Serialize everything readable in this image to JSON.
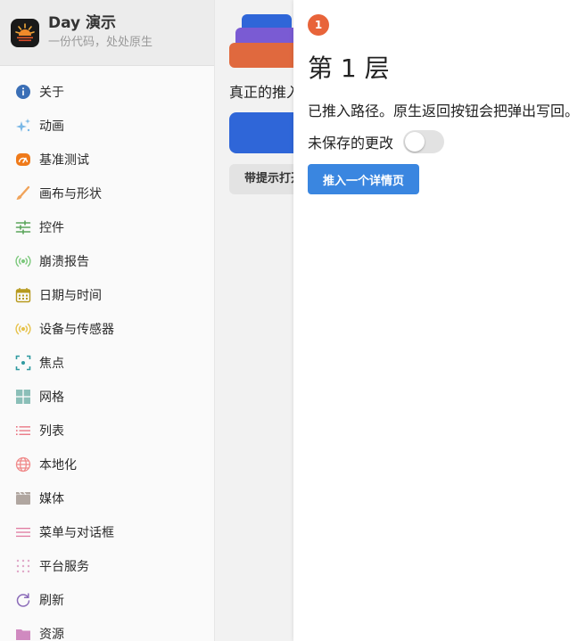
{
  "sidebar": {
    "app_name": "Day 演示",
    "app_subtitle": "一份代码，处处原生",
    "items": [
      {
        "label": "关于",
        "icon": "info-icon",
        "color": "#3b6fb6"
      },
      {
        "label": "动画",
        "icon": "sparkles-icon",
        "color": "#7ab8e6"
      },
      {
        "label": "基准测试",
        "icon": "speedometer-icon",
        "color": "#ef7a1a"
      },
      {
        "label": "画布与形状",
        "icon": "brush-icon",
        "color": "#f0a35a"
      },
      {
        "label": "控件",
        "icon": "sliders-icon",
        "color": "#5aa55a"
      },
      {
        "label": "崩溃报告",
        "icon": "radio-waves-icon",
        "color": "#7cc87c"
      },
      {
        "label": "日期与时间",
        "icon": "calendar-icon",
        "color": "#b79a1e"
      },
      {
        "label": "设备与传感器",
        "icon": "sensor-icon",
        "color": "#e6c24a"
      },
      {
        "label": "焦点",
        "icon": "focus-icon",
        "color": "#2f9aa0"
      },
      {
        "label": "网格",
        "icon": "grid-icon",
        "color": "#8bbfb8"
      },
      {
        "label": "列表",
        "icon": "list-icon",
        "color": "#e8707e"
      },
      {
        "label": "本地化",
        "icon": "globe-icon",
        "color": "#f08a8a"
      },
      {
        "label": "媒体",
        "icon": "clapperboard-icon",
        "color": "#b0a6a0"
      },
      {
        "label": "菜单与对话框",
        "icon": "menu-icon",
        "color": "#e07aa0"
      },
      {
        "label": "平台服务",
        "icon": "dots-grid-icon",
        "color": "#e0a8c8"
      },
      {
        "label": "刷新",
        "icon": "refresh-icon",
        "color": "#8a6ab8"
      },
      {
        "label": "资源",
        "icon": "folder-icon",
        "color": "#d08ac0"
      }
    ]
  },
  "middle": {
    "text": "真正的推入",
    "button2_label": "带提示打开"
  },
  "panel": {
    "badge": "1",
    "title": "第 1 层",
    "description": "已推入路径。原生返回按钮会把弹出写回。",
    "unsaved_label": "未保存的更改",
    "unsaved_on": false,
    "push_button_label": "推入一个详情页"
  }
}
